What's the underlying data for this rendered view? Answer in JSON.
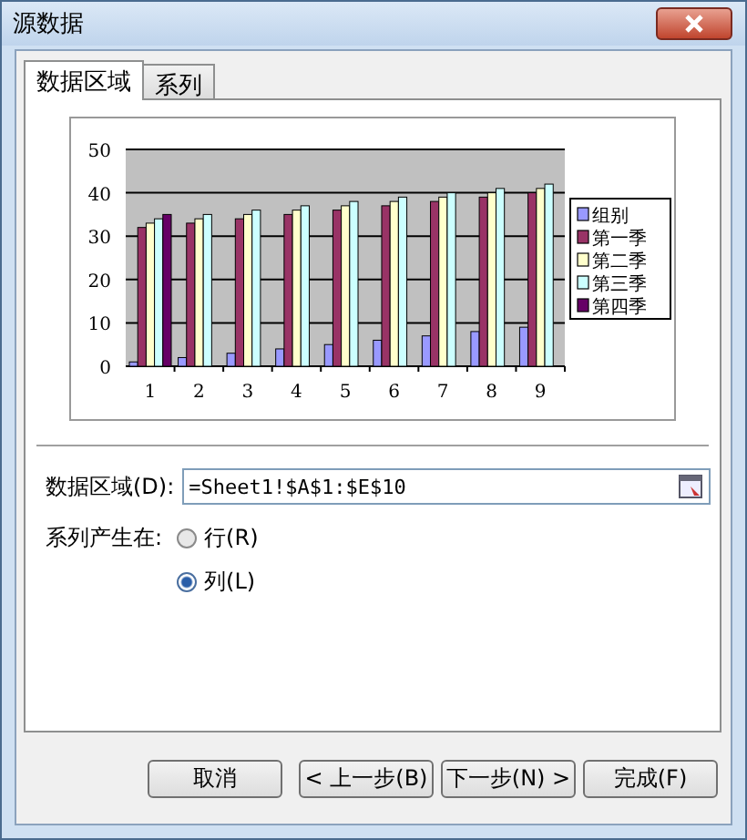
{
  "window": {
    "title": "源数据"
  },
  "tabs": [
    {
      "label": "数据区域",
      "selected": true
    },
    {
      "label": "系列",
      "selected": false
    }
  ],
  "chart": {
    "chart_data": {
      "type": "bar",
      "categories": [
        "1",
        "2",
        "3",
        "4",
        "5",
        "6",
        "7",
        "8",
        "9"
      ],
      "ylim": [
        0,
        50
      ],
      "grid": true,
      "legend": "right",
      "yticks": [
        0,
        10,
        20,
        30,
        40,
        50
      ],
      "series": [
        {
          "name": "组别",
          "color": "#9999ff",
          "values": [
            1,
            2,
            3,
            4,
            5,
            6,
            7,
            8,
            9
          ]
        },
        {
          "name": "第一季",
          "color": "#993366",
          "values": [
            32,
            33,
            34,
            35,
            36,
            37,
            38,
            39,
            40
          ]
        },
        {
          "name": "第二季",
          "color": "#ffffcc",
          "values": [
            33,
            34,
            35,
            36,
            37,
            38,
            39,
            40,
            41
          ]
        },
        {
          "name": "第三季",
          "color": "#ccffff",
          "values": [
            34,
            35,
            36,
            37,
            38,
            39,
            40,
            41,
            42
          ]
        },
        {
          "name": "第四季",
          "color": "#660066",
          "values": [
            35,
            null,
            null,
            null,
            null,
            null,
            null,
            null,
            null
          ]
        }
      ]
    }
  },
  "data_range": {
    "label": "数据区域(D):",
    "value": "=Sheet1!$A$1:$E$10"
  },
  "series_in": {
    "label": "系列产生在:",
    "options": [
      {
        "label": "行(R)",
        "selected": false
      },
      {
        "label": "列(L)",
        "selected": true
      }
    ]
  },
  "buttons": [
    "取消",
    "< 上一步(B)",
    "下一步(N) >",
    "完成(F)"
  ]
}
